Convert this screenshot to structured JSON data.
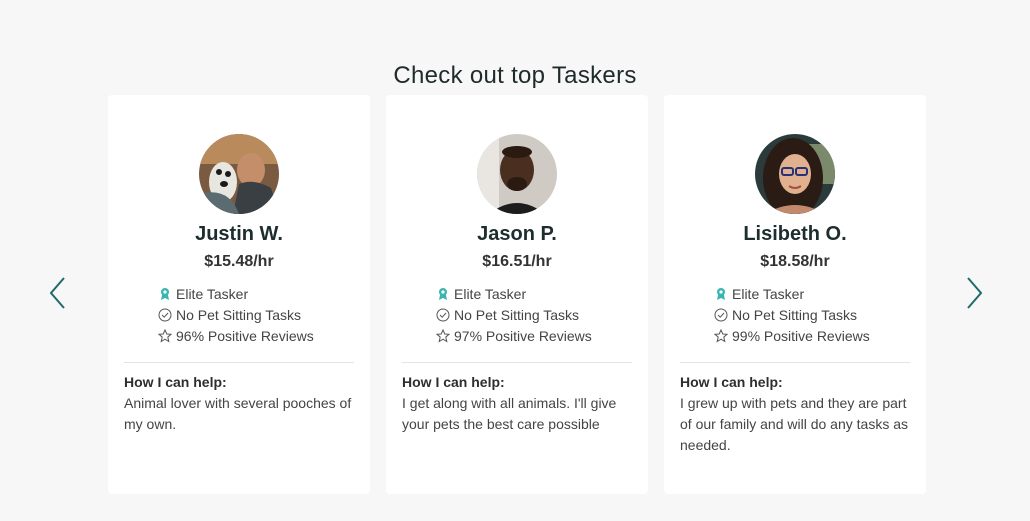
{
  "page": {
    "heading": "Check out top Taskers"
  },
  "carousel": {
    "prev_icon": "chevron-left-icon",
    "next_icon": "chevron-right-icon",
    "arrow_color": "#1f6a6a"
  },
  "taskers": [
    {
      "name": "Justin W.",
      "rate": "$15.48/hr",
      "badge": "Elite Tasker",
      "tasks": "No Pet Sitting Tasks",
      "reviews": "96% Positive Reviews",
      "help_label": "How I can help:",
      "help_text": "Animal lover with several pooches of my own."
    },
    {
      "name": "Jason P.",
      "rate": "$16.51/hr",
      "badge": "Elite Tasker",
      "tasks": "No Pet Sitting Tasks",
      "reviews": "97% Positive Reviews",
      "help_label": "How I can help:",
      "help_text": "I get along with all animals. I'll give your pets the best care possible"
    },
    {
      "name": "Lisibeth O.",
      "rate": "$18.58/hr",
      "badge": "Elite Tasker",
      "tasks": "No Pet Sitting Tasks",
      "reviews": "99% Positive Reviews",
      "help_label": "How I can help:",
      "help_text": "I grew up with pets and they are part of our family and will do any tasks as needed."
    }
  ],
  "colors": {
    "background": "#f7f7f8",
    "card": "#ffffff",
    "badge_icon": "#3bb5b0"
  }
}
